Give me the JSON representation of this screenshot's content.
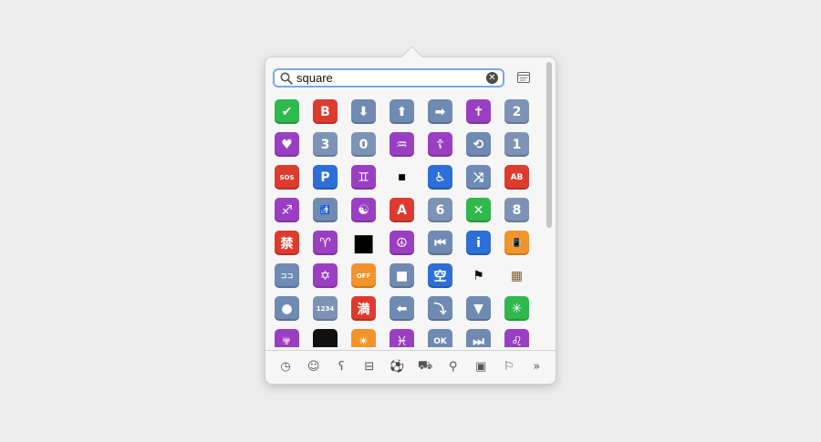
{
  "search": {
    "value": "square",
    "clear_icon": "clear-icon"
  },
  "view_toggle_icon": "character-viewer-icon",
  "emoji_grid": [
    {
      "label": "✔",
      "name": "check-mark-icon",
      "bg": "#2fb84c"
    },
    {
      "label": "B",
      "name": "blood-type-b-icon",
      "bg": "#de3b2f"
    },
    {
      "label": "⬇",
      "name": "down-arrow-icon",
      "bg": "#6f8ab3"
    },
    {
      "label": "⬆",
      "name": "up-arrow-icon",
      "bg": "#6f8ab3"
    },
    {
      "label": "➡",
      "name": "right-arrow-icon",
      "bg": "#6f8ab3"
    },
    {
      "label": "✝",
      "name": "latin-cross-icon",
      "bg": "#9a3fc2"
    },
    {
      "label": "2",
      "name": "keycap-2-icon",
      "bg": "#7d93b5"
    },
    {
      "label": "♥",
      "name": "heart-suit-icon",
      "bg": "#9a3fc2"
    },
    {
      "label": "3",
      "name": "keycap-3-icon",
      "bg": "#7d93b5"
    },
    {
      "label": "0",
      "name": "keycap-0-icon",
      "bg": "#7d93b5"
    },
    {
      "label": "♒",
      "name": "aquarius-icon",
      "bg": "#9a3fc2"
    },
    {
      "label": "☦",
      "name": "orthodox-cross-icon",
      "bg": "#9a3fc2"
    },
    {
      "label": "⟲",
      "name": "repeat-icon",
      "bg": "#6f8ab3"
    },
    {
      "label": "1",
      "name": "keycap-1-icon",
      "bg": "#7d93b5"
    },
    {
      "label": "SOS",
      "name": "sos-button-icon",
      "bg": "#de3b2f",
      "cls": "tiny"
    },
    {
      "label": "P",
      "name": "parking-icon",
      "bg": "#2d6fd6"
    },
    {
      "label": "♊",
      "name": "gemini-icon",
      "bg": "#9a3fc2"
    },
    {
      "label": "■",
      "name": "black-small-square-icon",
      "bg": "transparent",
      "fg": "#000",
      "cls": "small"
    },
    {
      "label": "♿",
      "name": "wheelchair-icon",
      "bg": "#2d6fd6"
    },
    {
      "label": "⤨",
      "name": "shuffle-icon",
      "bg": "#6f8ab3"
    },
    {
      "label": "AB",
      "name": "blood-type-ab-icon",
      "bg": "#de3b2f",
      "cls": "small"
    },
    {
      "label": "♐",
      "name": "sagittarius-icon",
      "bg": "#9a3fc2"
    },
    {
      "label": "🚮",
      "name": "litter-icon",
      "bg": "#6f8ab3",
      "cls": "small"
    },
    {
      "label": "☯",
      "name": "yin-yang-icon",
      "bg": "#9a3fc2"
    },
    {
      "label": "A",
      "name": "blood-type-a-icon",
      "bg": "#de3b2f"
    },
    {
      "label": "6",
      "name": "keycap-6-icon",
      "bg": "#7d93b5"
    },
    {
      "label": "✕",
      "name": "cross-mark-button-icon",
      "bg": "#2fb84c"
    },
    {
      "label": "8",
      "name": "keycap-8-icon",
      "bg": "#7d93b5"
    },
    {
      "label": "禁",
      "name": "prohibited-button-icon",
      "bg": "#de3b2f"
    },
    {
      "label": "♈",
      "name": "aries-icon",
      "bg": "#9a3fc2"
    },
    {
      "label": "■",
      "name": "black-medium-square-icon",
      "bg": "transparent",
      "fg": "#000",
      "cls": "big"
    },
    {
      "label": "☮",
      "name": "peace-icon",
      "bg": "#9a3fc2"
    },
    {
      "label": "⏮",
      "name": "previous-track-icon",
      "bg": "#6f8ab3"
    },
    {
      "label": "i",
      "name": "information-icon",
      "bg": "#2d6fd6"
    },
    {
      "label": "📳",
      "name": "vibration-mode-icon",
      "bg": "#f3942a",
      "cls": "small"
    },
    {
      "label": "ココ",
      "name": "katakana-koko-icon",
      "bg": "#6f8ab3",
      "cls": "tiny"
    },
    {
      "label": "✡",
      "name": "star-of-david-icon",
      "bg": "#9a3fc2"
    },
    {
      "label": "OFF",
      "name": "mobile-phone-off-icon",
      "bg": "#f3942a",
      "cls": "tiny"
    },
    {
      "label": "■",
      "name": "stop-button-icon",
      "bg": "#6f8ab3"
    },
    {
      "label": "空",
      "name": "vacancy-button-icon",
      "bg": "#2d6fd6"
    },
    {
      "label": "⚑",
      "name": "black-flag-icon",
      "bg": "transparent",
      "fg": "#111"
    },
    {
      "label": "▦",
      "name": "abacus-icon",
      "bg": "transparent",
      "fg": "#8a5a2b"
    },
    {
      "label": "●",
      "name": "record-button-icon",
      "bg": "#6f8ab3"
    },
    {
      "label": "1234",
      "name": "input-numbers-icon",
      "bg": "#7d93b5",
      "cls": "tiny"
    },
    {
      "label": "満",
      "name": "no-vacancy-button-icon",
      "bg": "#de3b2f"
    },
    {
      "label": "⬅",
      "name": "left-arrow-icon",
      "bg": "#6f8ab3"
    },
    {
      "label": "⤵",
      "name": "right-arrow-curving-down-icon",
      "bg": "#6f8ab3"
    },
    {
      "label": "▼",
      "name": "down-button-icon",
      "bg": "#6f8ab3"
    },
    {
      "label": "✳",
      "name": "eight-spoked-asterisk-icon",
      "bg": "#2fb84c"
    },
    {
      "label": "🕎",
      "name": "menorah-icon",
      "bg": "#9a3fc2",
      "cls": "small"
    },
    {
      "label": "",
      "name": "black-large-square-icon",
      "bg": "#111"
    },
    {
      "label": "✴",
      "name": "eight-pointed-star-icon",
      "bg": "#f3942a"
    },
    {
      "label": "♓",
      "name": "pisces-icon",
      "bg": "#9a3fc2"
    },
    {
      "label": "OK",
      "name": "ok-button-icon",
      "bg": "#6f8ab3",
      "cls": "small"
    },
    {
      "label": "⏭",
      "name": "next-track-icon",
      "bg": "#6f8ab3"
    },
    {
      "label": "♌",
      "name": "leo-icon",
      "bg": "#9a3fc2"
    }
  ],
  "category_bar": [
    {
      "name": "recent-clock-icon",
      "glyph": "◷"
    },
    {
      "name": "smiley-icon",
      "glyph": "☺"
    },
    {
      "name": "animals-bear-icon",
      "glyph": "ʕ"
    },
    {
      "name": "food-cake-icon",
      "glyph": "⊟"
    },
    {
      "name": "activity-ball-icon",
      "glyph": "⚽"
    },
    {
      "name": "travel-car-icon",
      "glyph": "⛟"
    },
    {
      "name": "objects-lightbulb-icon",
      "glyph": "⚲"
    },
    {
      "name": "symbols-icon",
      "glyph": "▣"
    },
    {
      "name": "flag-icon",
      "glyph": "⚐"
    },
    {
      "name": "more-chevron-icon",
      "glyph": "»"
    }
  ]
}
